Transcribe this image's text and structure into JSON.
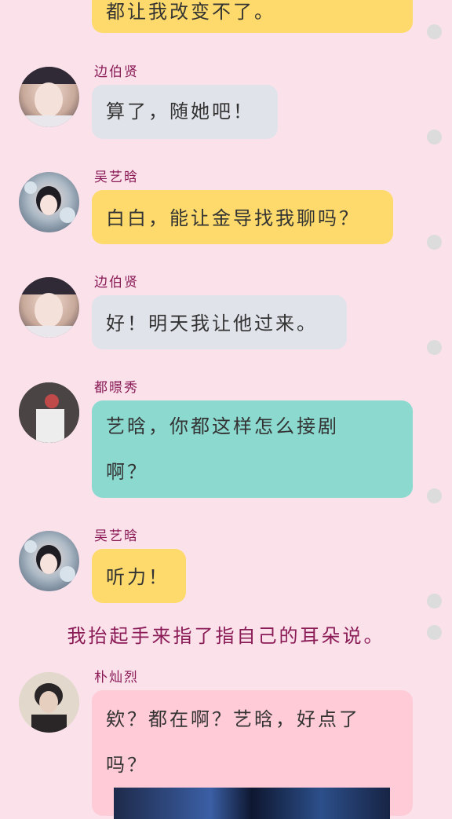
{
  "messages": [
    {
      "name": "",
      "text": "都让我改变不了。",
      "color": "#fdda6b"
    },
    {
      "name": "边伯贤",
      "text": "算了，随她吧！",
      "color": "#e1e3ea"
    },
    {
      "name": "吴艺晗",
      "text": "白白，能让金导找我聊吗？",
      "color": "#fdda6b"
    },
    {
      "name": "边伯贤",
      "text": "好！明天我让他过来。",
      "color": "#e1e3ea"
    },
    {
      "name": "都暻秀",
      "text_line1": "艺晗，你都这样怎么接剧",
      "text_line2": "啊？",
      "color": "#8bd9cf"
    },
    {
      "name": "吴艺晗",
      "text": "听力！",
      "color": "#fdda6b"
    },
    {
      "name": "朴灿烈",
      "text_line1": "欸？都在啊？艺晗，好点了",
      "text_line2": "吗？",
      "color": "#ffcbd7"
    }
  ],
  "narration": "我抬起手来指了指自己的耳朵说。"
}
